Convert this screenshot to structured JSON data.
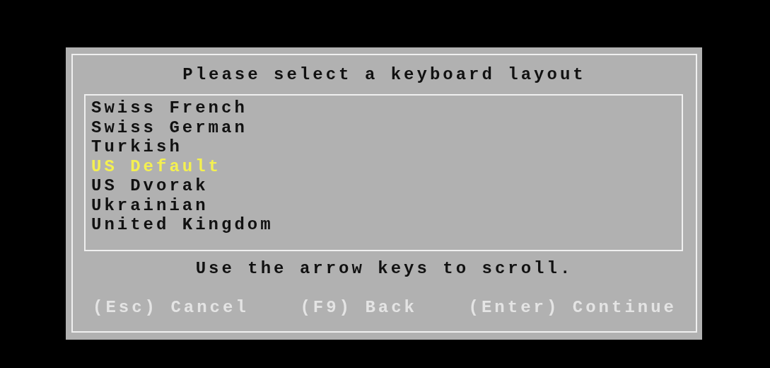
{
  "dialog": {
    "title": "Please select a keyboard layout",
    "items": [
      {
        "label": "Swiss French",
        "selected": false
      },
      {
        "label": "Swiss German",
        "selected": false
      },
      {
        "label": "Turkish",
        "selected": false
      },
      {
        "label": "US Default",
        "selected": true
      },
      {
        "label": "US Dvorak",
        "selected": false
      },
      {
        "label": "Ukrainian",
        "selected": false
      },
      {
        "label": "United Kingdom",
        "selected": false
      }
    ],
    "hint": "Use the arrow keys to scroll.",
    "actions": [
      "(Esc) Cancel",
      "(F9) Back",
      "(Enter) Continue"
    ]
  }
}
